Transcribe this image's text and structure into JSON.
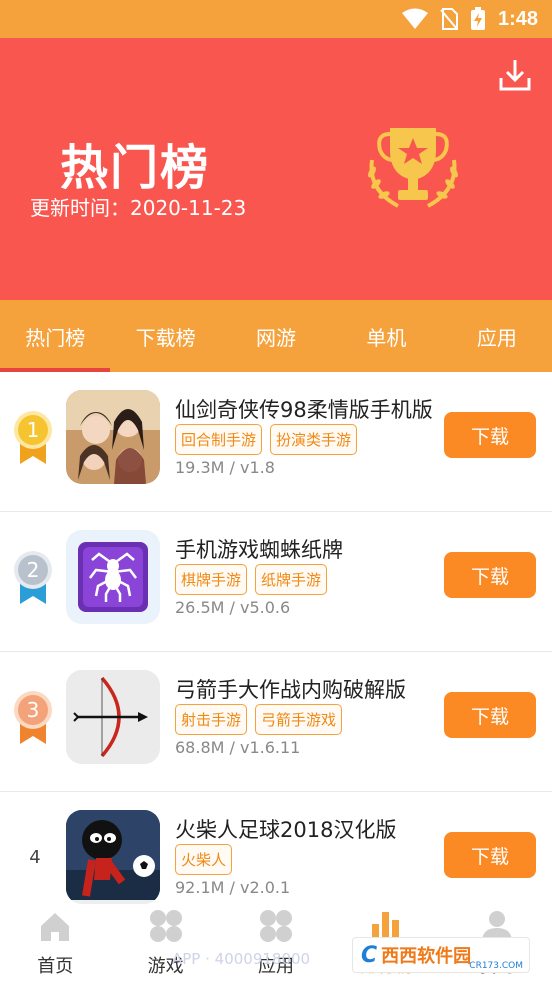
{
  "status": {
    "time": "1:48",
    "colors": {
      "bar": "#f5a13c"
    }
  },
  "banner": {
    "title": "热门榜",
    "update_label": "更新时间：2020-11-23",
    "download_icon": "download-icon",
    "trophy_icon": "trophy-icon",
    "bg_color": "#f9564f"
  },
  "tabs": [
    {
      "label": "热门榜",
      "active": true
    },
    {
      "label": "下载榜",
      "active": false
    },
    {
      "label": "网游",
      "active": false
    },
    {
      "label": "单机",
      "active": false
    },
    {
      "label": "应用",
      "active": false
    }
  ],
  "apps": [
    {
      "rank": "1",
      "medal": "gold-medal-icon",
      "name": "仙剑奇侠传98柔情版手机版",
      "tags": [
        "回合制手游",
        "扮演类手游"
      ],
      "meta": "19.3M / v1.8",
      "button": "下载"
    },
    {
      "rank": "2",
      "medal": "silver-medal-icon",
      "name": "手机游戏蜘蛛纸牌",
      "tags": [
        "棋牌手游",
        "纸牌手游"
      ],
      "meta": "26.5M / v5.0.6",
      "button": "下载"
    },
    {
      "rank": "3",
      "medal": "bronze-medal-icon",
      "name": "弓箭手大作战内购破解版",
      "tags": [
        "射击手游",
        "弓箭手游戏"
      ],
      "meta": "68.8M / v1.6.11",
      "button": "下载"
    },
    {
      "rank": "4",
      "medal": "",
      "name": "火柴人足球2018汉化版",
      "tags": [
        "火柴人"
      ],
      "meta": "92.1M / v2.0.1",
      "button": "下载"
    }
  ],
  "bottom_nav": [
    {
      "label": "首页",
      "icon": "home-icon"
    },
    {
      "label": "游戏",
      "icon": "games-grid-icon"
    },
    {
      "label": "应用",
      "icon": "apps-grid-icon"
    },
    {
      "label": "排行榜",
      "icon": "ranking-bars-icon"
    },
    {
      "label": "我的",
      "icon": "user-icon"
    }
  ],
  "watermark": {
    "logo": "C",
    "text": "西西软件园",
    "url": "CR173.COM",
    "faint_text": "APP · 4000918000"
  }
}
